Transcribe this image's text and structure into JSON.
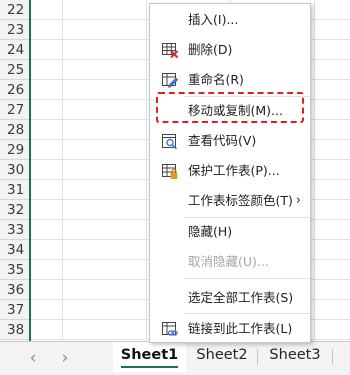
{
  "rows": [
    "22",
    "23",
    "24",
    "25",
    "26",
    "27",
    "28",
    "29",
    "30",
    "31",
    "32",
    "33",
    "34",
    "35",
    "36",
    "37",
    "38"
  ],
  "context_menu": {
    "items": [
      {
        "label": "插入(I)...",
        "icon": "",
        "disabled": false
      },
      {
        "label": "删除(D)",
        "icon": "delete-sheet-icon",
        "disabled": false
      },
      {
        "label": "重命名(R)",
        "icon": "rename-sheet-icon",
        "disabled": false
      },
      {
        "label": "移动或复制(M)...",
        "icon": "",
        "disabled": false,
        "highlighted": true
      },
      {
        "label": "查看代码(V)",
        "icon": "view-code-icon",
        "disabled": false
      },
      {
        "label": "保护工作表(P)...",
        "icon": "protect-sheet-icon",
        "disabled": false
      },
      {
        "label": "工作表标签颜色(T)",
        "icon": "",
        "disabled": false,
        "submenu": true
      },
      {
        "label": "隐藏(H)",
        "icon": "",
        "disabled": false
      },
      {
        "label": "取消隐藏(U)...",
        "icon": "",
        "disabled": true
      },
      {
        "label": "选定全部工作表(S)",
        "icon": "",
        "disabled": false
      },
      {
        "label": "链接到此工作表(L)",
        "icon": "link-to-sheet-icon",
        "disabled": false
      }
    ],
    "submenu_arrow": "›"
  },
  "sheet_tabs": {
    "nav_prev": "‹",
    "nav_next": "›",
    "tabs": [
      {
        "label": "Sheet1",
        "active": true
      },
      {
        "label": "Sheet2",
        "active": false
      },
      {
        "label": "Sheet3",
        "active": false
      }
    ]
  },
  "colors": {
    "accent": "#217346",
    "highlight_border": "#e02020"
  }
}
